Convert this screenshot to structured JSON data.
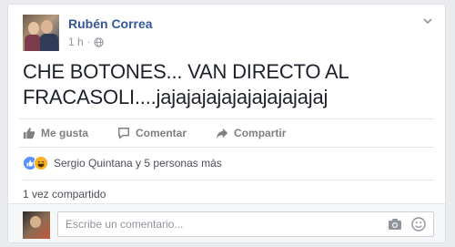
{
  "post": {
    "author": "Rubén Correa",
    "time": "1 h",
    "meta_separator": "·",
    "text": "CHE BOTONES... VAN DIRECTO AL FRACASOLI....jajajajajajajajajajajaj"
  },
  "actions": {
    "like_label": "Me gusta",
    "comment_label": "Comentar",
    "share_label": "Compartir"
  },
  "reactions": {
    "summary": "Sergio Quintana y 5 personas más"
  },
  "shares": {
    "label": "1 vez compartido"
  },
  "comment_box": {
    "placeholder": "Escribe un comentario..."
  },
  "colors": {
    "author_link": "#365899",
    "background": "#e9ebee",
    "like_blue": "#5890ff",
    "haha_yellow": "#f7b125"
  },
  "icons": [
    "chevron-down-icon",
    "globe-icon",
    "thumbs-up-icon",
    "comment-icon",
    "share-arrow-icon",
    "like-reaction-icon",
    "haha-reaction-icon",
    "camera-icon",
    "emoji-icon"
  ]
}
